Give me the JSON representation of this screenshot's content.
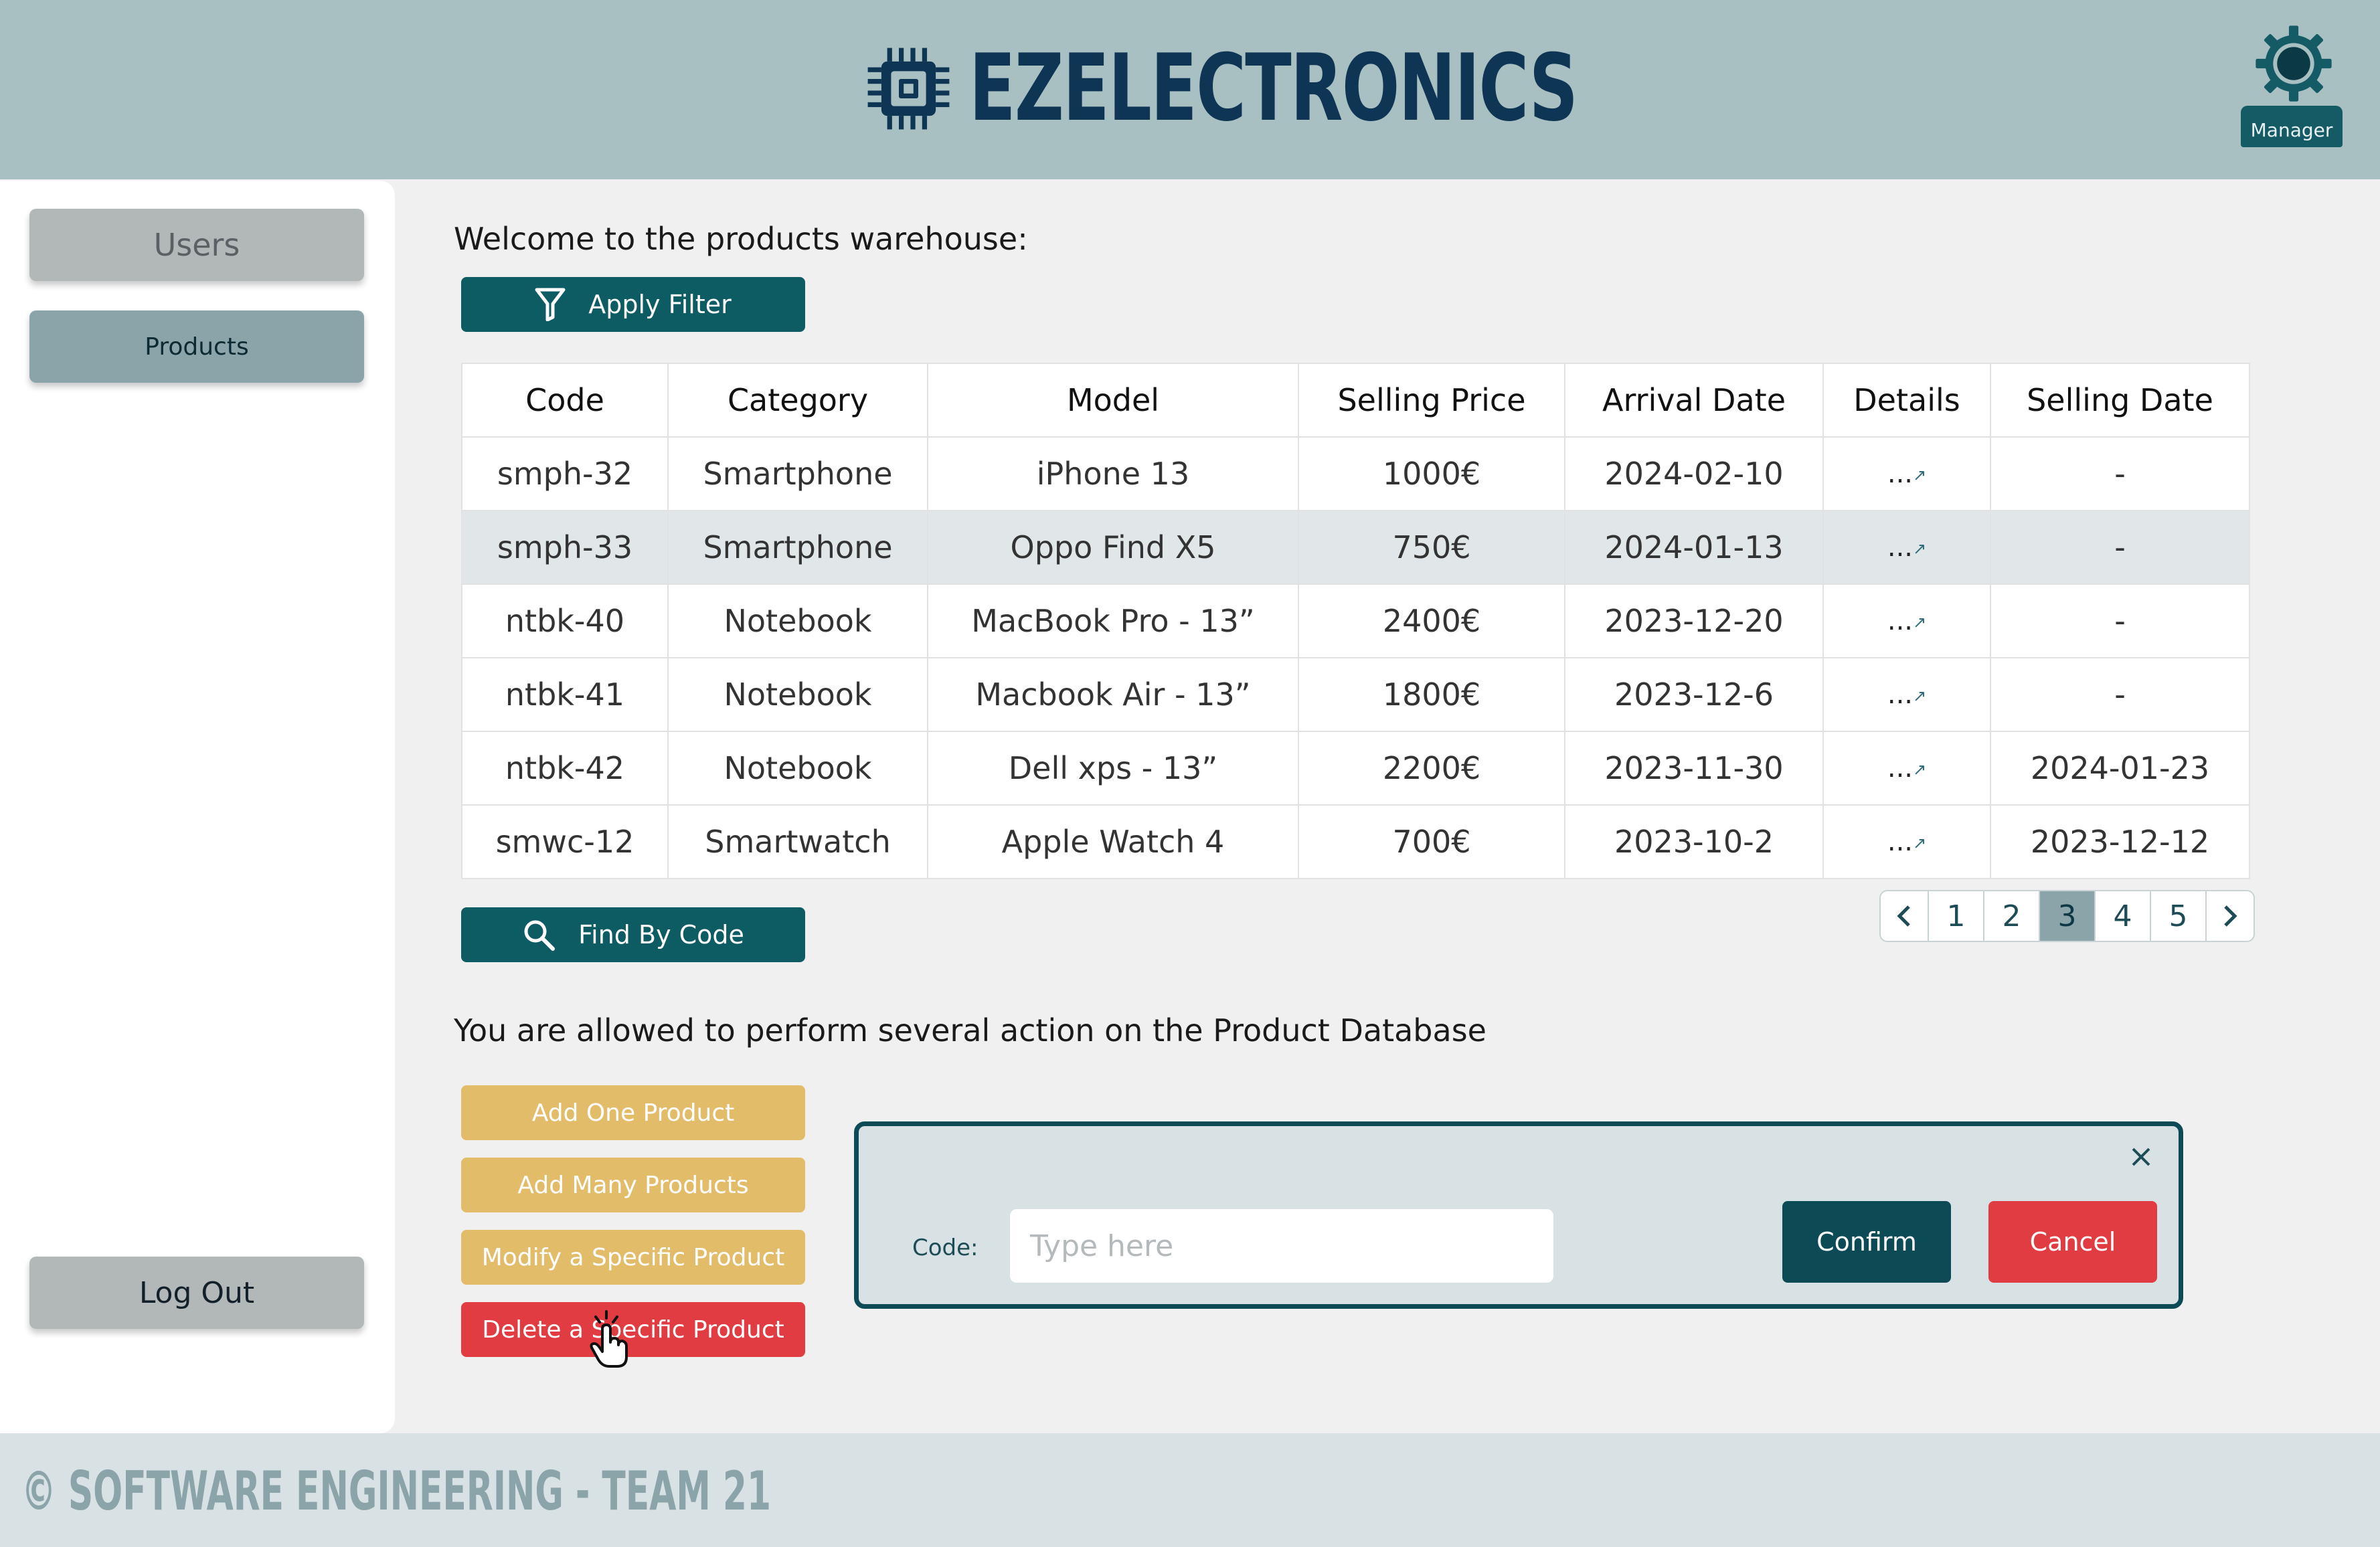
{
  "header": {
    "brand": "EZELECTRONICS",
    "logo_icon": "chip-icon",
    "user_role": "Manager",
    "user_icon": "gear-icon"
  },
  "sidebar": {
    "items": [
      {
        "label": "Users"
      },
      {
        "label": "Products"
      }
    ],
    "logout_label": "Log Out"
  },
  "main": {
    "welcome": "Welcome to the products warehouse:",
    "apply_filter_label": "Apply Filter",
    "find_by_code_label": "Find By Code",
    "table": {
      "columns": [
        "Code",
        "Category",
        "Model",
        "Selling Price",
        "Arrival Date",
        "Details",
        "Selling Date"
      ],
      "rows": [
        [
          "smph-32",
          "Smartphone",
          "iPhone 13",
          "1000€",
          "2024-02-10",
          "...",
          "-"
        ],
        [
          "smph-33",
          "Smartphone",
          "Oppo Find X5",
          "750€",
          "2024-01-13",
          "...",
          "-"
        ],
        [
          "ntbk-40",
          "Notebook",
          "MacBook Pro - 13”",
          "2400€",
          "2023-12-20",
          "...",
          "-"
        ],
        [
          "ntbk-41",
          "Notebook",
          "Macbook Air - 13”",
          "1800€",
          "2023-12-6",
          "...",
          "-"
        ],
        [
          "ntbk-42",
          "Notebook",
          "Dell xps - 13”",
          "2200€",
          "2023-11-30",
          "...",
          "2024-01-23"
        ],
        [
          "smwc-12",
          "Smartwatch",
          "Apple Watch 4",
          "700€",
          "2023-10-2",
          "...",
          "2023-12-12"
        ]
      ],
      "highlighted_row": 1
    },
    "pagination": {
      "pages": [
        "1",
        "2",
        "3",
        "4",
        "5"
      ],
      "current": "3"
    },
    "allowed_text": "You are allowed to perform several action on the Product Database",
    "actions": {
      "add_one": "Add One Product",
      "add_many": "Add Many Products",
      "modify": "Modify a Specific Product",
      "delete": "Delete a Specific Product"
    }
  },
  "dialog": {
    "code_label": "Code:",
    "code_placeholder": "Type here",
    "confirm_label": "Confirm",
    "cancel_label": "Cancel"
  },
  "footer": {
    "text": "© SOFTWARE ENGINEERING - TEAM 21"
  },
  "colors": {
    "header_bg": "#a9c0c3",
    "primary": "#0d5b63",
    "accent_yellow": "#e3bc6a",
    "danger": "#e03c41",
    "brand_text": "#0f3555"
  }
}
